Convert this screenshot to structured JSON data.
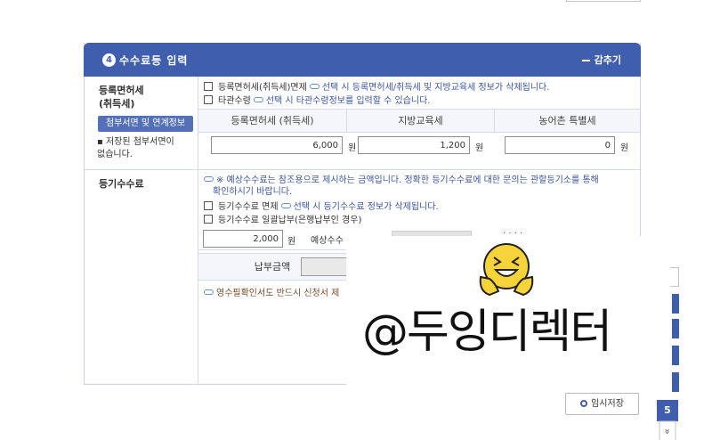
{
  "panel": {
    "step_number": "4",
    "title": "수수료등 입력",
    "collapse_label": "감추기"
  },
  "registration_tax": {
    "label": "등록면허세\n(취득세)",
    "attach_button": "첨부서면 및 연계정보",
    "no_attachment_text": "▪ 저장된 첨부서면이\n  없습니다.",
    "exemption_checkbox": {
      "label": "등록면허세(취득세)면제",
      "note": "선택 시 등록면허세/취득세 및 지방교육세 정보가 삭제됩니다."
    },
    "other_office_checkbox": {
      "label": "타관수령",
      "note": "선택 시 타관수령정보를 입력할 수 있습니다."
    },
    "columns": [
      "등록면허세 (취득세)",
      "지방교육세",
      "농어촌 특별세"
    ],
    "values": [
      "6,000",
      "1,200",
      "0"
    ],
    "unit": "원"
  },
  "registry_fee": {
    "label": "등기수수료",
    "notice_line1": "※ 예상수수료는 참조용으로 제시하는 금액입니다. 정확한 등기수수료에 대한 문의는 관할등기소를 통해",
    "notice_line2": "확인하시기 바랍니다.",
    "exemption_checkbox": {
      "label": "등기수수료 면제",
      "note": "선택 시 등기수수료 정보가 삭제됩니다."
    },
    "bulk_payment_checkbox": {
      "label": "등기수수료 일괄납부(은행납부인 경우)"
    },
    "fee_value": "2,000",
    "unit": "원",
    "expected_fee_label": "예상수수",
    "payment_amount_label": "납부금액",
    "receipt_note": "영수필확인서도 반드시 신청서 제"
  },
  "overlay": {
    "watermark_text": "@두잉디렉터"
  },
  "controls": {
    "temp_save_label": "임시저장",
    "page_number": "5",
    "scroll_down_icon": "double-chevron-down-icon"
  },
  "colors": {
    "header_blue": "#3f5fae",
    "button_blue": "#5470b7",
    "notice_blue": "#3b55a0",
    "smiley_yellow": "#f7d33a"
  }
}
